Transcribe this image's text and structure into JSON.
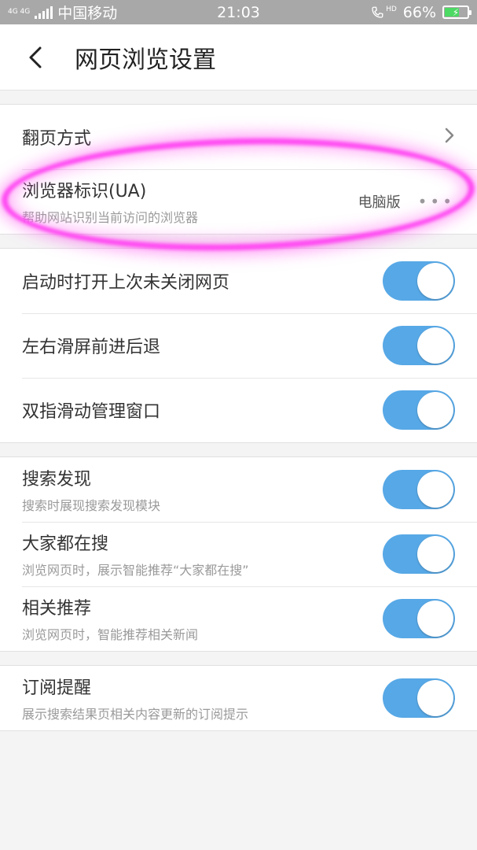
{
  "status_bar": {
    "network_type": "4G 4G",
    "carrier": "中国移动",
    "time": "21:03",
    "call_hd": "HD",
    "battery": "66%",
    "battery_level": 0.66,
    "battery_color": "#4cd964"
  },
  "header": {
    "title": "网页浏览设置",
    "back_icon": "chevron-left-icon"
  },
  "groups": [
    {
      "items": [
        {
          "title": "翻页方式",
          "control": "chevron"
        },
        {
          "title": "浏览器标识(UA)",
          "subtitle": "帮助网站识别当前访问的浏览器",
          "value": "电脑版",
          "control": "dots",
          "dots": "•••"
        }
      ]
    },
    {
      "items": [
        {
          "title": "启动时打开上次未关闭网页",
          "toggle": true
        },
        {
          "title": "左右滑屏前进后退",
          "toggle": true
        },
        {
          "title": "双指滑动管理窗口",
          "toggle": true
        }
      ]
    },
    {
      "items": [
        {
          "title": "搜索发现",
          "subtitle": "搜索时展现搜索发现模块",
          "toggle": true
        },
        {
          "title": "大家都在搜",
          "subtitle": "浏览网页时，展示智能推荐“大家都在搜”",
          "toggle": true
        },
        {
          "title": "相关推荐",
          "subtitle": "浏览网页时，智能推荐相关新闻",
          "toggle": true
        }
      ]
    },
    {
      "items": [
        {
          "title": "订阅提醒",
          "subtitle": "展示搜索结果页相关内容更新的订阅提示",
          "toggle": true
        }
      ]
    }
  ],
  "colors": {
    "toggle_on": "#57a8e6",
    "annotation": "#ff4cf2"
  }
}
